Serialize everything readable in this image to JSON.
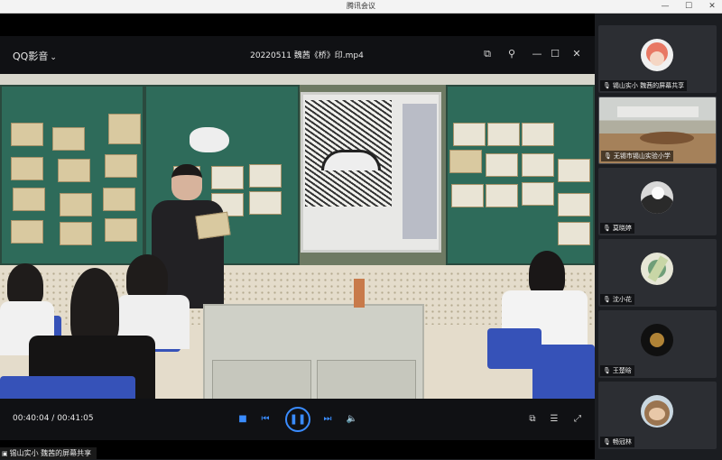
{
  "window": {
    "title": "腾讯会议",
    "controls": [
      "—",
      "☐",
      "✕"
    ]
  },
  "player": {
    "brand": "QQ影音",
    "brand_chevron": "⌄",
    "file_name": "20220511 魏茜《桥》印.mp4",
    "top_tools": [
      "screenshot-icon",
      "pin-icon",
      "maximize-icon",
      "close-icon"
    ],
    "current_time": "00:40:04",
    "time_separator": " / ",
    "total_time": "00:41:05",
    "controls": [
      "stop-icon",
      "previous-icon",
      "pause-icon",
      "next-icon",
      "volume-icon"
    ],
    "right_tools": [
      "screenshot-icon",
      "settings-icon",
      "fullscreen-icon"
    ]
  },
  "share_label": "锡山实小 魏茜的屏幕共享",
  "participants": [
    {
      "name": "锡山实小 魏茜的屏幕共享",
      "type": "avatar",
      "avatar_color": "#e87864",
      "avatar_bg": "#f0f0f0"
    },
    {
      "name": "无锡市锡山实验小学",
      "type": "video"
    },
    {
      "name": "莫晓婷",
      "type": "avatar",
      "avatar_color": "#2a2a2a",
      "avatar_bg": "#d8d8d8"
    },
    {
      "name": "沈小花",
      "type": "avatar",
      "avatar_color": "#6f9e78",
      "avatar_bg": "#e6e6d6"
    },
    {
      "name": "王楚晗",
      "type": "avatar",
      "avatar_color": "#d8a040",
      "avatar_bg": "#101010"
    },
    {
      "name": "畅冠林",
      "type": "avatar",
      "avatar_color": "#9a7450",
      "avatar_bg": "#c9d7e0"
    }
  ],
  "colors": {
    "accent": "#3a8cff",
    "panel_bg": "#1b1d21",
    "tile_bg": "#2c2e33"
  }
}
